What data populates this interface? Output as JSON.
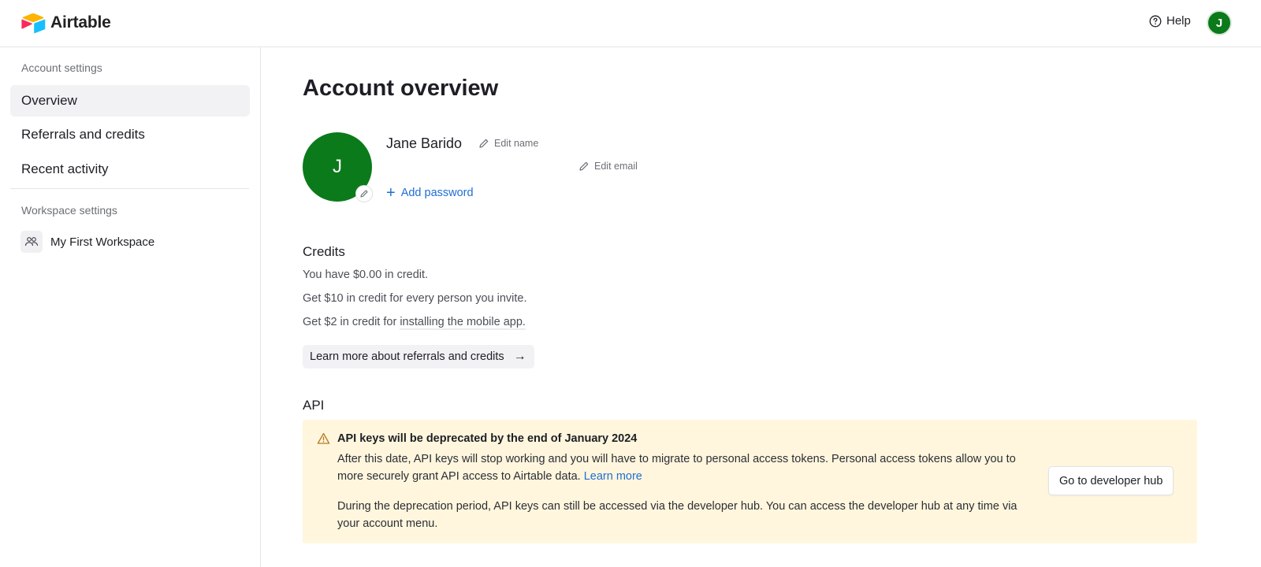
{
  "app": {
    "name": "Airtable",
    "brand_colors": {
      "red": "#f82b60",
      "yellow": "#fcb400",
      "blue": "#18bfff",
      "navy": "#2d7ff9"
    }
  },
  "topbar": {
    "help_label": "Help",
    "help_icon": "question-circle-icon",
    "avatar_initial": "J",
    "avatar_color": "#0b7a1a"
  },
  "sidebar": {
    "account_section_label": "Account settings",
    "account_items": [
      {
        "label": "Overview",
        "active": true
      },
      {
        "label": "Referrals and credits",
        "active": false
      },
      {
        "label": "Recent activity",
        "active": false
      }
    ],
    "workspace_section_label": "Workspace settings",
    "workspaces": [
      {
        "label": "My First Workspace",
        "icon": "users-icon"
      }
    ]
  },
  "main": {
    "title": "Account overview",
    "profile": {
      "avatar_initial": "J",
      "name": "Jane Barido",
      "edit_name_label": "Edit name",
      "edit_email_label": "Edit email",
      "add_password_label": "Add password"
    },
    "credits": {
      "heading": "Credits",
      "balance_text": "You have $0.00 in credit.",
      "invite_text": "Get $10 in credit for every person you invite.",
      "mobile_prefix": "Get $2 in credit for ",
      "mobile_link": "installing the mobile app.",
      "learn_more_button": "Learn more about referrals and credits"
    },
    "api": {
      "heading": "API",
      "banner_title": "API keys will be deprecated by the end of January 2024",
      "banner_p1": "After this date, API keys will stop working and you will have to migrate to personal access tokens. Personal access tokens allow you to more securely grant API access to Airtable data.",
      "banner_p1_link": "Learn more",
      "banner_p2": "During the deprecation period, API keys can still be accessed via the developer hub. You can access the developer hub at any time via your account menu.",
      "developer_hub_button": "Go to developer hub",
      "banner_color": "#fff6dd"
    }
  }
}
